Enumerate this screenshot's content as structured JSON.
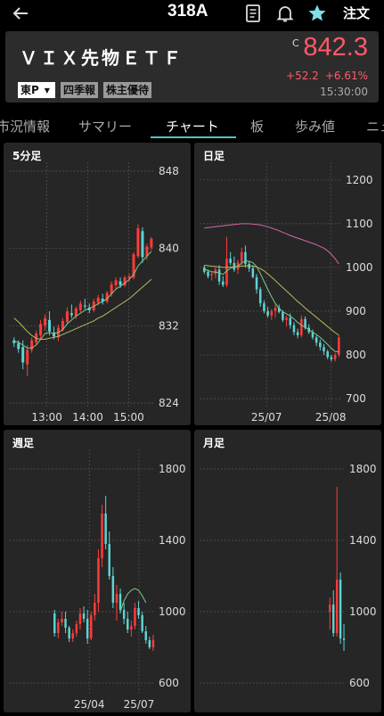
{
  "header": {
    "code": "318A",
    "order_label": "注文",
    "name": "ＶＩＸ先物ＥＴＦ",
    "market": "東P",
    "badges": [
      "四季報",
      "株主優待"
    ],
    "c_mark": "C",
    "price": "842.3",
    "change": "+52.2",
    "change_pct": "+6.61%",
    "time": "15:30:00"
  },
  "tabs": [
    "市況情報",
    "サマリー",
    "チャート",
    "板",
    "歩み値",
    "ニュ"
  ],
  "active_tab": "チャート",
  "colors": {
    "up": "#ff3b3b",
    "down": "#5fd3d3",
    "accent": "#4fc3c3",
    "price": "#ff5a6a"
  },
  "chart_data": [
    {
      "title": "5分足",
      "type": "candlestick",
      "ylim": [
        824,
        848
      ],
      "yticks": [
        "848",
        "840",
        "832",
        "824"
      ],
      "xticks": [
        "13:00",
        "14:00",
        "15:00"
      ],
      "candles": [
        [
          830.5,
          830.8,
          829.8,
          830.2
        ],
        [
          830.2,
          830.5,
          829.2,
          829.6
        ],
        [
          829.8,
          830.5,
          827.5,
          828.2
        ],
        [
          828.0,
          830.0,
          826.8,
          829.5
        ],
        [
          829.5,
          830.8,
          829.2,
          830.5
        ],
        [
          830.3,
          831.5,
          830.0,
          831.2
        ],
        [
          831.0,
          832.6,
          830.6,
          832.2
        ],
        [
          832.0,
          833.2,
          831.5,
          832.8
        ],
        [
          832.6,
          833.5,
          831.0,
          831.4
        ],
        [
          831.3,
          831.9,
          830.6,
          830.9
        ],
        [
          830.8,
          832.1,
          830.4,
          831.8
        ],
        [
          831.6,
          832.8,
          831.4,
          832.5
        ],
        [
          832.4,
          833.9,
          832.2,
          833.5
        ],
        [
          833.3,
          834.2,
          832.8,
          833.1
        ],
        [
          833.0,
          834.0,
          832.7,
          833.8
        ],
        [
          833.6,
          834.6,
          833.4,
          834.3
        ],
        [
          834.1,
          834.8,
          833.7,
          834.0
        ],
        [
          833.9,
          834.3,
          833.3,
          833.6
        ],
        [
          833.6,
          834.8,
          833.4,
          834.5
        ],
        [
          834.4,
          835.2,
          834.1,
          834.9
        ],
        [
          834.8,
          835.3,
          834.2,
          834.5
        ],
        [
          834.5,
          835.6,
          834.3,
          835.4
        ],
        [
          835.3,
          836.6,
          835.0,
          836.3
        ],
        [
          836.2,
          837.0,
          835.8,
          836.7
        ],
        [
          836.6,
          837.0,
          835.9,
          836.2
        ],
        [
          836.2,
          837.2,
          836.0,
          837.0
        ],
        [
          836.9,
          837.4,
          836.5,
          837.1
        ],
        [
          837.0,
          839.6,
          836.8,
          839.4
        ],
        [
          839.2,
          842.5,
          839.0,
          842.1
        ],
        [
          841.8,
          842.2,
          838.5,
          839.1
        ],
        [
          839.2,
          840.5,
          838.8,
          840.2
        ],
        [
          840.1,
          841.2,
          839.8,
          841.0
        ]
      ],
      "ma": [
        {
          "color": "#7ec98a",
          "values": [
            830.4,
            830.3,
            830.0,
            829.7,
            829.7,
            830.0,
            830.6,
            831.2,
            831.3,
            831.2,
            831.3,
            831.6,
            832.2,
            832.6,
            833.0,
            833.3,
            833.6,
            833.8,
            834.0,
            834.3,
            834.5,
            834.8,
            835.3,
            835.8,
            836.1,
            836.4,
            836.8,
            837.3,
            838.2,
            838.7,
            839.2,
            839.7
          ]
        },
        {
          "color": "#b8b860",
          "values": [
            832.8,
            832.4,
            831.9,
            831.4,
            831.0,
            830.7,
            830.6,
            830.6,
            830.7,
            830.8,
            830.9,
            831.1,
            831.3,
            831.5,
            831.7,
            831.9,
            832.1,
            832.3,
            832.5,
            832.8,
            833.0,
            833.3,
            833.6,
            833.9,
            834.2,
            834.5,
            834.8,
            835.2,
            835.6,
            836.0,
            836.4,
            836.8
          ]
        }
      ]
    },
    {
      "title": "日足",
      "type": "candlestick",
      "ylim": [
        690,
        1220
      ],
      "yticks": [
        "1200",
        "1100",
        "1000",
        "900",
        "800",
        "700"
      ],
      "xticks": [
        "25/07",
        "25/08"
      ],
      "candles": [
        [
          1000,
          1005,
          985,
          990
        ],
        [
          990,
          995,
          975,
          980
        ],
        [
          982,
          990,
          970,
          985
        ],
        [
          985,
          1000,
          975,
          995
        ],
        [
          995,
          1005,
          960,
          968
        ],
        [
          968,
          980,
          955,
          960
        ],
        [
          960,
          1070,
          955,
          1020
        ],
        [
          1020,
          1035,
          1005,
          1010
        ],
        [
          1010,
          1025,
          990,
          995
        ],
        [
          995,
          1018,
          985,
          1012
        ],
        [
          1012,
          1045,
          1005,
          1035
        ],
        [
          1035,
          1050,
          1000,
          1008
        ],
        [
          1008,
          1015,
          990,
          998
        ],
        [
          998,
          1005,
          975,
          978
        ],
        [
          978,
          985,
          940,
          950
        ],
        [
          950,
          955,
          910,
          918
        ],
        [
          918,
          925,
          895,
          900
        ],
        [
          900,
          910,
          885,
          890
        ],
        [
          890,
          905,
          880,
          900
        ],
        [
          900,
          915,
          885,
          908
        ],
        [
          908,
          915,
          895,
          898
        ],
        [
          898,
          902,
          875,
          880
        ],
        [
          880,
          890,
          865,
          885
        ],
        [
          885,
          895,
          860,
          868
        ],
        [
          868,
          875,
          845,
          852
        ],
        [
          852,
          860,
          838,
          845
        ],
        [
          845,
          890,
          840,
          882
        ],
        [
          882,
          888,
          858,
          862
        ],
        [
          862,
          870,
          848,
          852
        ],
        [
          852,
          858,
          835,
          840
        ],
        [
          840,
          845,
          820,
          828
        ],
        [
          828,
          835,
          810,
          818
        ],
        [
          818,
          825,
          800,
          808
        ],
        [
          808,
          812,
          790,
          795
        ],
        [
          795,
          800,
          785,
          790
        ],
        [
          790,
          805,
          785,
          800
        ],
        [
          800,
          845,
          795,
          840
        ]
      ],
      "ma": [
        {
          "color": "#7ec98a",
          "values": [
            996,
            993,
            990,
            989,
            988,
            984,
            992,
            998,
            1001,
            1003,
            1010,
            1015,
            1014,
            1011,
            1002,
            986,
            968,
            950,
            933,
            918,
            906,
            899,
            894,
            889,
            882,
            874,
            868,
            863,
            858,
            852,
            847,
            840,
            832,
            824,
            815,
            808,
            807
          ]
        },
        {
          "color": "#b8b860",
          "values": [
            1005,
            1004,
            1003,
            1002,
            1001,
            1000,
            1000,
            1001,
            1001,
            1002,
            1003,
            1004,
            1004,
            1003,
            1001,
            997,
            992,
            985,
            978,
            970,
            962,
            954,
            946,
            938,
            930,
            922,
            915,
            907,
            900,
            893,
            886,
            879,
            872,
            865,
            858,
            851,
            845
          ]
        },
        {
          "color": "#d966a6",
          "values": [
            1090,
            1091,
            1092,
            1093,
            1094,
            1095,
            1096,
            1097,
            1098,
            1099,
            1100,
            1100,
            1100,
            1099,
            1098,
            1097,
            1095,
            1093,
            1090,
            1087,
            1084,
            1080,
            1077,
            1073,
            1070,
            1067,
            1064,
            1061,
            1058,
            1055,
            1052,
            1048,
            1044,
            1038,
            1030,
            1020,
            1008
          ]
        }
      ]
    },
    {
      "title": "週足",
      "type": "candlestick",
      "ylim": [
        560,
        1860
      ],
      "yticks": [
        "1800",
        "1400",
        "1000",
        "600"
      ],
      "xticks": [
        "25/04",
        "25/07"
      ],
      "candles": [
        [
          990,
          1010,
          860,
          880
        ],
        [
          880,
          960,
          850,
          940
        ],
        [
          940,
          1000,
          920,
          960
        ],
        [
          960,
          1000,
          880,
          910
        ],
        [
          910,
          920,
          830,
          850
        ],
        [
          850,
          900,
          830,
          880
        ],
        [
          880,
          950,
          860,
          930
        ],
        [
          930,
          1020,
          900,
          990
        ],
        [
          990,
          1030,
          940,
          960
        ],
        [
          960,
          1010,
          820,
          850
        ],
        [
          850,
          1000,
          840,
          980
        ],
        [
          980,
          1100,
          950,
          1050
        ],
        [
          1050,
          1350,
          1000,
          1300
        ],
        [
          1300,
          1600,
          1250,
          1550
        ],
        [
          1550,
          1650,
          1350,
          1380
        ],
        [
          1380,
          1450,
          1180,
          1200
        ],
        [
          1200,
          1250,
          1020,
          1050
        ],
        [
          1050,
          1150,
          950,
          1100
        ],
        [
          1100,
          1130,
          990,
          1010
        ],
        [
          1010,
          1050,
          930,
          960
        ],
        [
          960,
          1000,
          880,
          900
        ],
        [
          900,
          950,
          860,
          920
        ],
        [
          920,
          1050,
          900,
          1020
        ],
        [
          1020,
          1060,
          960,
          980
        ],
        [
          980,
          1000,
          880,
          890
        ],
        [
          890,
          920,
          820,
          840
        ],
        [
          840,
          860,
          790,
          800
        ],
        [
          800,
          870,
          780,
          842
        ]
      ],
      "ma": [
        {
          "color": "#7ec98a",
          "values": [
            null,
            null,
            null,
            null,
            null,
            null,
            null,
            null,
            null,
            null,
            null,
            null,
            null,
            null,
            null,
            null,
            null,
            null,
            1000,
            1060,
            1100,
            1120,
            1130,
            1120,
            1090,
            1050,
            null,
            null
          ]
        }
      ]
    },
    {
      "title": "月足",
      "type": "candlestick",
      "ylim": [
        560,
        1860
      ],
      "yticks": [
        "1800",
        "1400",
        "1000",
        "600"
      ],
      "xticks": [],
      "candles": [
        [
          1000,
          1080,
          900,
          1040
        ],
        [
          1040,
          1120,
          860,
          880
        ],
        [
          880,
          1700,
          860,
          1180
        ],
        [
          1180,
          1220,
          820,
          850
        ],
        [
          850,
          930,
          780,
          842
        ]
      ]
    }
  ]
}
